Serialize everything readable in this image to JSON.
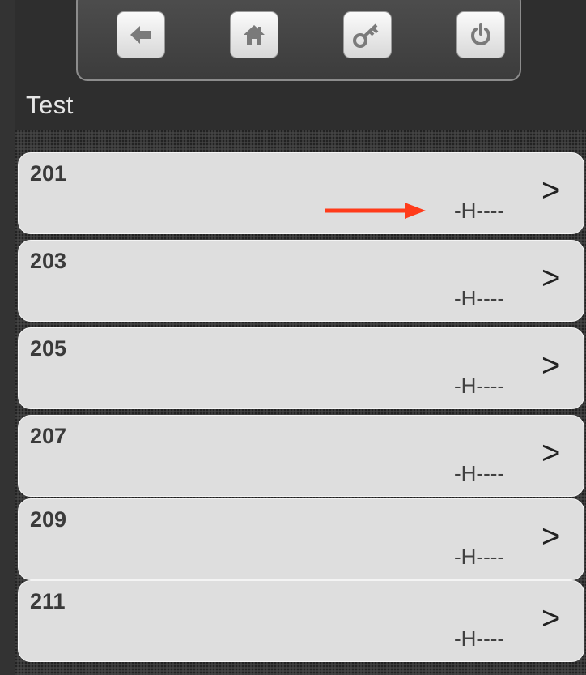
{
  "toolbar": {
    "buttons": [
      {
        "icon": "back-arrow-icon"
      },
      {
        "icon": "home-icon"
      },
      {
        "icon": "key-icon"
      },
      {
        "icon": "power-icon"
      }
    ]
  },
  "screen": {
    "title": "Test"
  },
  "list": {
    "items": [
      {
        "name": "201",
        "status": "-H----",
        "chevron": ">"
      },
      {
        "name": "203",
        "status": "-H----",
        "chevron": ">"
      },
      {
        "name": "205",
        "status": "-H----",
        "chevron": ">"
      },
      {
        "name": "207",
        "status": "-H----",
        "chevron": ">"
      },
      {
        "name": "209",
        "status": "-H----",
        "chevron": ">"
      },
      {
        "name": "211",
        "status": "-H----",
        "chevron": ">"
      }
    ]
  },
  "annotation": {
    "arrow_color": "#ff3b1a"
  },
  "colors": {
    "icon_fill": "#7a7a7a"
  }
}
